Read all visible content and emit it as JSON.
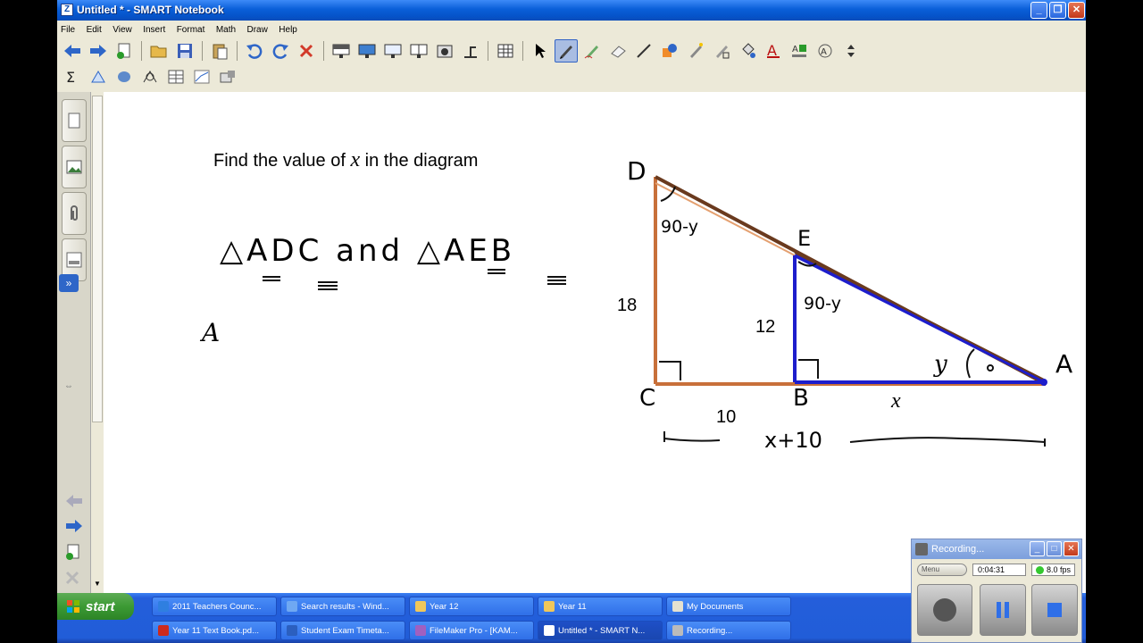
{
  "window": {
    "title": "Untitled * - SMART Notebook"
  },
  "menu": [
    "File",
    "Edit",
    "View",
    "Insert",
    "Format",
    "Math",
    "Draw",
    "Help"
  ],
  "icons": {
    "toolbar_row1": [
      "back-icon",
      "forward-icon",
      "add-page-icon",
      "open-icon",
      "save-icon",
      "paste-icon",
      "undo-icon",
      "redo-icon",
      "delete-icon",
      "screen-shade-icon",
      "full-screen-icon",
      "transparent-background-icon",
      "dual-page-icon",
      "capture-icon",
      "document-camera-icon",
      "table-icon",
      "select-icon",
      "pen-icon",
      "creative-pen-icon",
      "eraser-icon",
      "line-icon",
      "shape-icon",
      "magic-pen-icon",
      "shape-recognition-pen-icon",
      "fill-icon",
      "text-icon",
      "properties-icon",
      "fonts-icon",
      "move-toolbar-icon"
    ],
    "toolbar_row2": [
      "math-sum-icon",
      "shape-tool-icon",
      "3d-icon",
      "geometry-icon",
      "table-tool-icon",
      "graph-icon",
      "measurement-icon"
    ]
  },
  "canvas": {
    "typed_prefix": "Find the value of ",
    "typed_var": "x",
    "typed_suffix": " in the diagram",
    "handwritten": {
      "similar_line": "△ADC and △AEB",
      "partial": "A",
      "vertex_D": "D",
      "vertex_E": "E",
      "vertex_C": "C",
      "vertex_B": "B",
      "vertex_A": "A",
      "angle_D": "90-y",
      "angle_E": "90-y",
      "angle_A": "y",
      "bottom_span": "x+10"
    },
    "labels": {
      "dc": "18",
      "eb": "12",
      "cb": "10",
      "ba": "x"
    }
  },
  "taskbar": {
    "start": "start",
    "tasks": [
      {
        "label": "2011 Teachers Counc...",
        "icon": "ie-icon"
      },
      {
        "label": "Search results - Wind...",
        "icon": "search-icon"
      },
      {
        "label": "Year 12",
        "icon": "folder-icon"
      },
      {
        "label": "Year 11",
        "icon": "folder-icon"
      },
      {
        "label": "My Documents",
        "icon": "my-documents-icon"
      },
      {
        "label": "Year 11 Text Book.pd...",
        "icon": "pdf-icon"
      },
      {
        "label": "Student Exam Timeta...",
        "icon": "word-icon"
      },
      {
        "label": "FileMaker Pro - [KAM...",
        "icon": "filemaker-icon"
      },
      {
        "label": "Untitled * - SMART N...",
        "icon": "smart-notebook-icon"
      },
      {
        "label": "Recording...",
        "icon": "recorder-icon"
      }
    ]
  },
  "recorder": {
    "title": "Recording...",
    "menu": "Menu",
    "time": "0:04:31",
    "fps": "8.0 fps",
    "status_color": "#34c830"
  },
  "colors": {
    "orange_triangle": "#c8703a",
    "blue_triangle": "#1d1dcc",
    "outline_brown": "#6a3a1e"
  }
}
